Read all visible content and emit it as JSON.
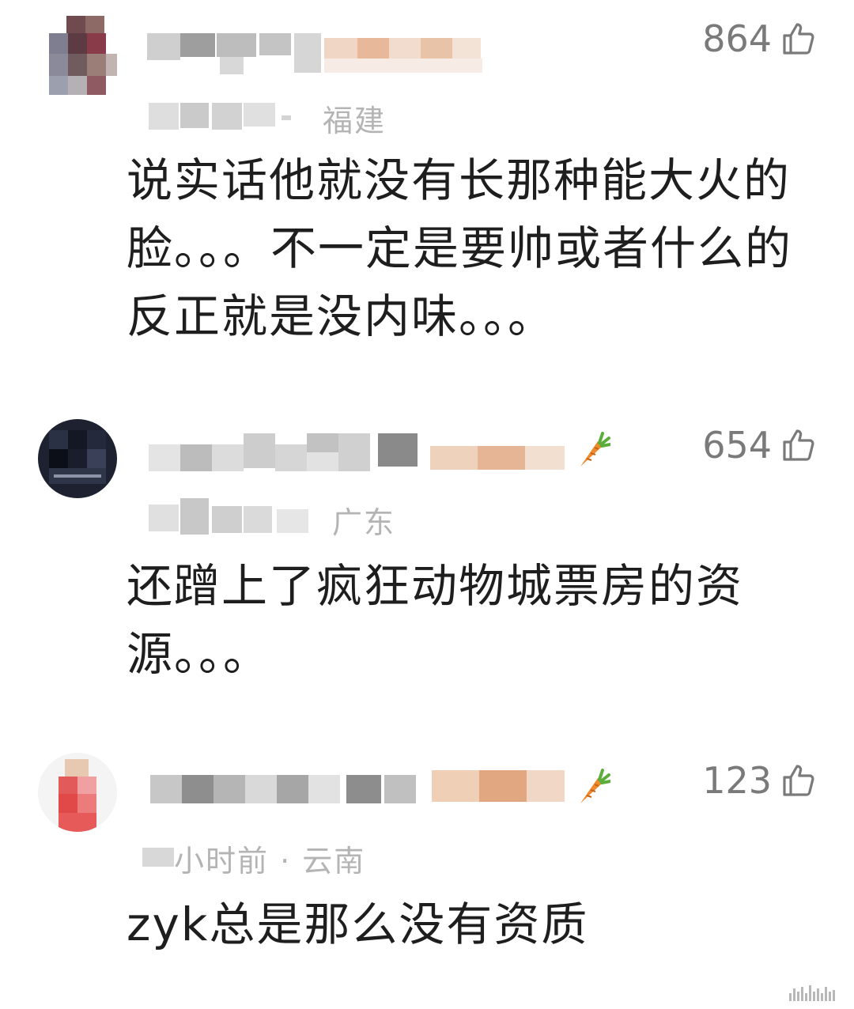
{
  "comments": [
    {
      "likes": "864",
      "meta_visible": "福建",
      "text": "说实话他就没有长那种能大火的脸。。。不一定是要帅或者什么的 反正就是没内味。。。"
    },
    {
      "likes": "654",
      "meta_visible": "广东",
      "text": "还蹭上了疯狂动物城票房的资源。。。"
    },
    {
      "likes": "123",
      "meta_visible": "小时前 · 云南",
      "text": "zyk总是那么没有资质"
    }
  ],
  "colors": {
    "text": "#1e1e1e",
    "meta": "#b4b4b4",
    "like": "#7a7a7a",
    "carrot": "#f08a2a"
  },
  "icons": {
    "like": "thumbs-up-icon",
    "badge": "carrot-icon"
  }
}
